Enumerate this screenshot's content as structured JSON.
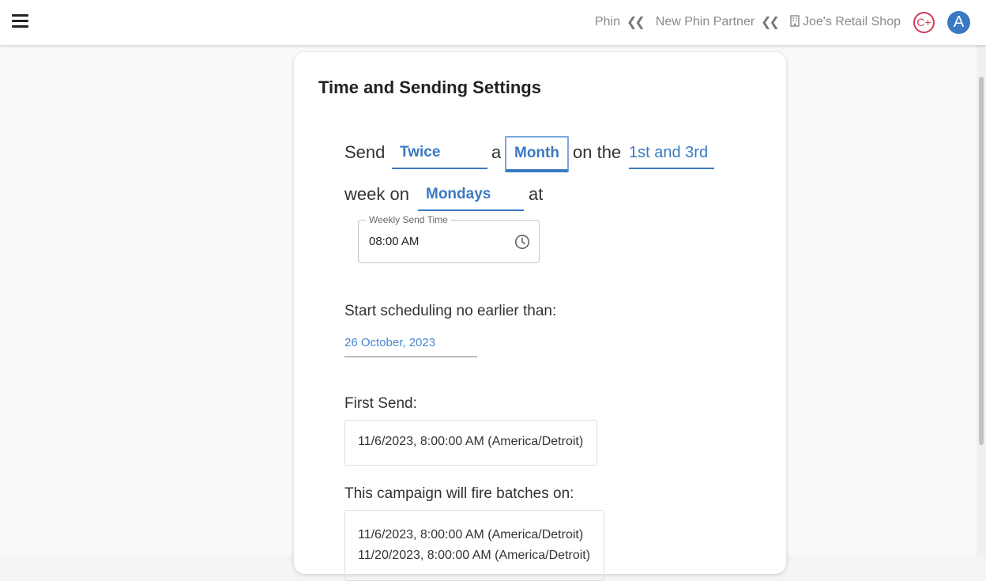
{
  "header": {
    "crumbs": [
      "Phin",
      "New Phin Partner",
      "Joe's Retail Shop"
    ],
    "badge": "C+",
    "avatar": "A"
  },
  "card": {
    "title": "Time and Sending Settings",
    "sentence": {
      "send": "Send",
      "frequency": "Twice",
      "a": "a",
      "period": "Month",
      "on_the": "on the",
      "weeks": "1st and 3rd",
      "week_on": "week on",
      "day": "Mondays",
      "at": "at"
    },
    "time_field": {
      "label": "Weekly Send Time",
      "value": "08:00 AM",
      "icon": "clock-icon"
    },
    "start_label": "Start scheduling no earlier than:",
    "start_date": "26 October, 2023",
    "first_send_label": "First Send:",
    "first_send_value": "11/6/2023, 8:00:00 AM (America/Detroit)",
    "batches_label": "This campaign will fire batches on:",
    "batches": [
      "11/6/2023, 8:00:00 AM (America/Detroit)",
      "11/20/2023, 8:00:00 AM (America/Detroit)"
    ]
  },
  "colors": {
    "accent": "#3b79c2",
    "badge": "#d63a5a"
  }
}
